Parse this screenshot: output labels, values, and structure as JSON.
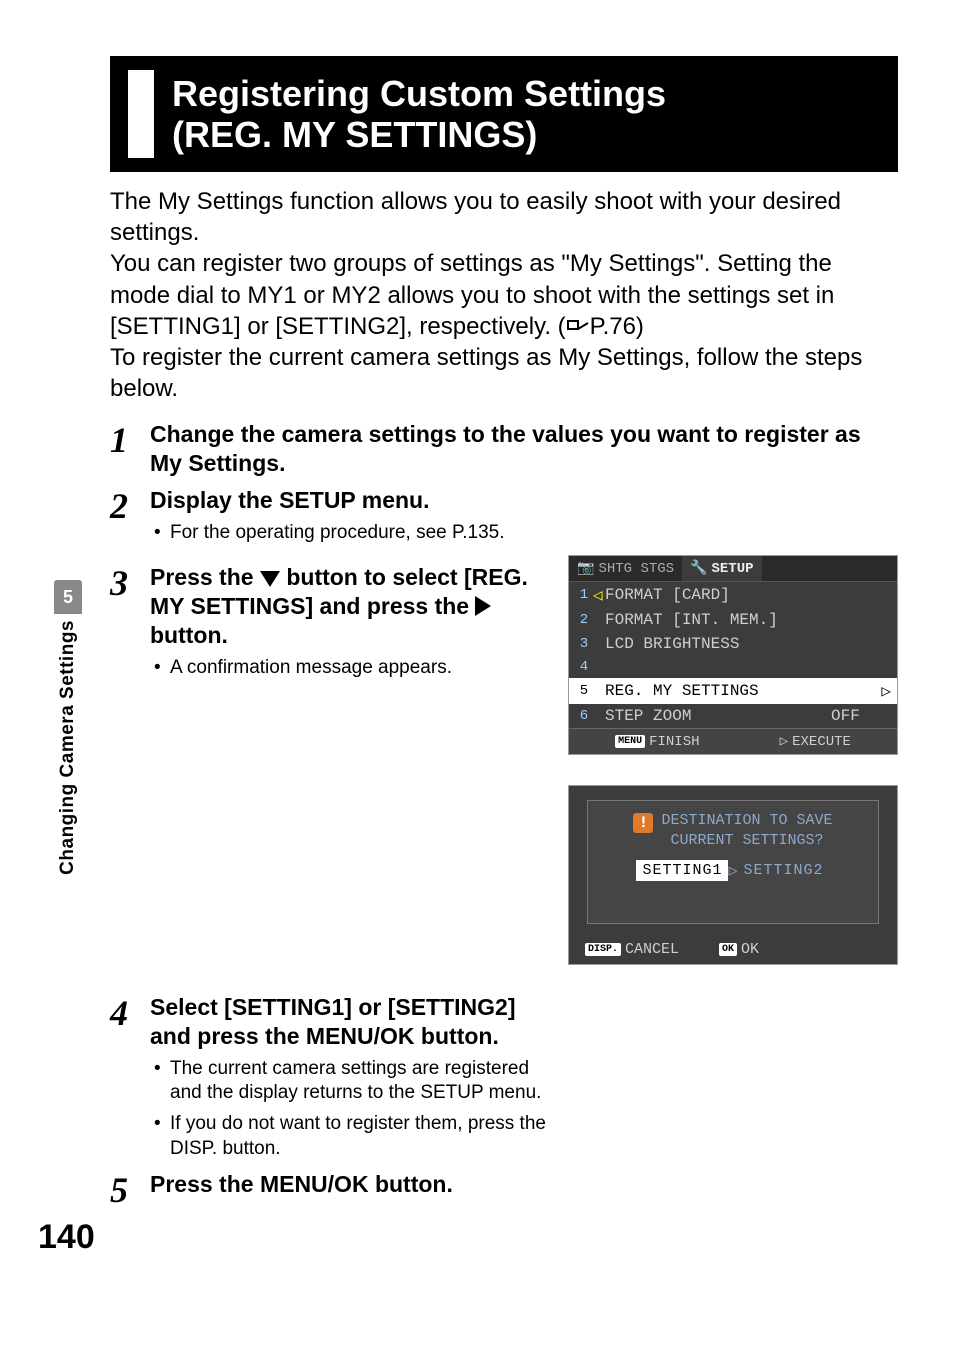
{
  "sidebar": {
    "chapter_number": "5",
    "chapter_title": "Changing Camera Settings"
  },
  "page_number": "140",
  "title": {
    "line1": "Registering Custom Settings",
    "line2": "(REG. MY SETTINGS)"
  },
  "intro": {
    "p1": "The My Settings function allows you to easily shoot with your desired settings.",
    "p2a": "You can register two groups of settings as \"My Settings\". Setting the mode dial to MY1 or MY2 allows you to shoot with the settings set in [SETTING1] or [SETTING2], respectively. (",
    "p2b": "P.76)",
    "p3": "To register the current camera settings as My Settings, follow the steps below."
  },
  "steps": {
    "s1": {
      "num": "1",
      "title": "Change the camera settings to the values you want to register as My Settings."
    },
    "s2": {
      "num": "2",
      "title": "Display the SETUP menu.",
      "sub1": "For the operating procedure, see P.135."
    },
    "s3": {
      "num": "3",
      "title_a": "Press the ",
      "title_b": " button to select [REG. MY SETTINGS] and press the ",
      "title_c": " button.",
      "sub1": "A confirmation message appears."
    },
    "s4": {
      "num": "4",
      "title": "Select [SETTING1] or [SETTING2] and press the MENU/OK button.",
      "sub1": "The current camera settings are registered and the display returns to the SETUP menu.",
      "sub2": "If you do not want to register them, press the DISP. button."
    },
    "s5": {
      "num": "5",
      "title": "Press the MENU/OK button."
    }
  },
  "setup_screen": {
    "tab1": "SHTG STGS",
    "tab3": "SETUP",
    "items": [
      {
        "n": "1",
        "cursor": "◁",
        "label": "FORMAT [CARD]",
        "value": ""
      },
      {
        "n": "2",
        "cursor": "",
        "label": "FORMAT [INT. MEM.]",
        "value": ""
      },
      {
        "n": "3",
        "cursor": "",
        "label": "LCD BRIGHTNESS",
        "value": ""
      },
      {
        "n": "4",
        "cursor": "",
        "label": "",
        "value": ""
      },
      {
        "n": "5",
        "cursor": "",
        "label": "REG. MY SETTINGS",
        "value": "",
        "selected": true,
        "arrow": "▷"
      },
      {
        "n": "6",
        "cursor": "",
        "label": "STEP ZOOM",
        "value": "OFF"
      }
    ],
    "footer_left_badge": "MENU",
    "footer_left": "FINISH",
    "footer_right_icon": "▷",
    "footer_right": "EXECUTE"
  },
  "confirm_screen": {
    "line1": "DESTINATION TO SAVE",
    "line2": "CURRENT SETTINGS?",
    "opt1": "SETTING1",
    "opt2": "SETTING2",
    "cancel_badge": "DISP.",
    "cancel": "CANCEL",
    "ok_badge": "OK",
    "ok": "OK"
  }
}
